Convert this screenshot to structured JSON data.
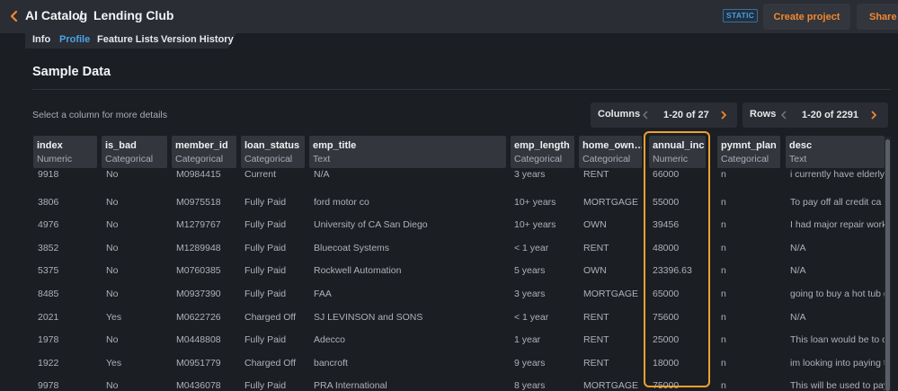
{
  "header": {
    "breadcrumb_root": "AI Catalog",
    "breadcrumb_separator": "/",
    "breadcrumb_current": "Lending Club",
    "badge": "STATIC",
    "create_project_label": "Create project",
    "share_label": "Share"
  },
  "tabs": [
    {
      "label": "Info",
      "active": false
    },
    {
      "label": "Profile",
      "active": true
    },
    {
      "label": "Feature Lists",
      "active": false
    },
    {
      "label": "Version History",
      "active": false
    }
  ],
  "sample": {
    "title": "Sample Data",
    "hint": "Select a column for more details",
    "columns_pager": {
      "label": "Columns",
      "range": "1-20 of 27"
    },
    "rows_pager": {
      "label": "Rows",
      "range": "1-20 of 2291"
    }
  },
  "columns": [
    {
      "name": "index",
      "type": "Numeric"
    },
    {
      "name": "is_bad",
      "type": "Categorical"
    },
    {
      "name": "member_id",
      "type": "Categorical"
    },
    {
      "name": "loan_status",
      "type": "Categorical"
    },
    {
      "name": "emp_title",
      "type": "Text"
    },
    {
      "name": "emp_length",
      "type": "Categorical"
    },
    {
      "name": "home_own…",
      "type": "Categorical"
    },
    {
      "name": "annual_inc",
      "type": "Numeric"
    },
    {
      "name": "pymnt_plan",
      "type": "Categorical"
    },
    {
      "name": "desc",
      "type": "Text"
    }
  ],
  "selected_column": "annual_inc",
  "rows": [
    [
      "9918",
      "No",
      "M0984415",
      "Current",
      "N/A",
      "3 years",
      "RENT",
      "66000",
      "n",
      "i currently have elderly"
    ],
    [
      "3806",
      "No",
      "M0975518",
      "Fully Paid",
      "ford motor co",
      "10+ years",
      "MORTGAGE",
      "55000",
      "n",
      "To pay off all credit ca"
    ],
    [
      "4976",
      "No",
      "M1279767",
      "Fully Paid",
      "University of CA San Diego",
      "10+ years",
      "OWN",
      "39456",
      "n",
      "I had major repair work"
    ],
    [
      "3852",
      "No",
      "M1289948",
      "Fully Paid",
      "Bluecoat Systems",
      "< 1 year",
      "RENT",
      "48000",
      "n",
      "N/A"
    ],
    [
      "5375",
      "No",
      "M0760385",
      "Fully Paid",
      "Rockwell Automation",
      "5 years",
      "OWN",
      "23396.63",
      "n",
      "N/A"
    ],
    [
      "8485",
      "No",
      "M0937390",
      "Fully Paid",
      "FAA",
      "3 years",
      "MORTGAGE",
      "65000",
      "n",
      "going to buy a hot tub g"
    ],
    [
      "2021",
      "Yes",
      "M0622726",
      "Charged Off",
      "SJ LEVINSON and SONS",
      "< 1 year",
      "RENT",
      "75600",
      "n",
      "N/A"
    ],
    [
      "1978",
      "No",
      "M0448808",
      "Fully Paid",
      "Adecco",
      "1 year",
      "RENT",
      "25000",
      "n",
      "This loan would be to c"
    ],
    [
      "1922",
      "Yes",
      "M0951779",
      "Charged Off",
      "bancroft",
      "9 years",
      "RENT",
      "18000",
      "n",
      "im looking into paying t"
    ],
    [
      "9978",
      "No",
      "M0436078",
      "Fully Paid",
      "PRA International",
      "8 years",
      "MORTGAGE",
      "75000",
      "n",
      "This will be used to pay"
    ]
  ],
  "colors": {
    "accent_orange": "#f08832",
    "active_tab_blue": "#4aa3e8",
    "highlight_border": "#f0a030"
  }
}
